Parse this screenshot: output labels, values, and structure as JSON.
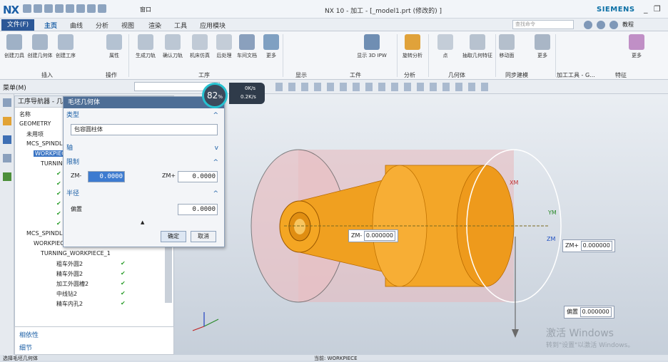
{
  "title_bar": {
    "logo": "NX",
    "qat_menu": "窗口",
    "title": "NX 10 - 加工 - [_model1.prt  (修改的) ]",
    "brand": "SIEMENS"
  },
  "menu_bar": {
    "file": "文件(F)",
    "tabs": [
      "主页",
      "曲线",
      "分析",
      "视图",
      "渲染",
      "工具",
      "应用模块"
    ],
    "search_placeholder": "查找命令",
    "tutorial": "教程"
  },
  "ribbon": {
    "buttons": [
      {
        "label": "创建刀具",
        "icon": "create-tool-icon"
      },
      {
        "label": "创建几何体",
        "icon": "create-geometry-icon"
      },
      {
        "label": "创建工序",
        "icon": "create-operation-icon"
      },
      {
        "label": "属性",
        "icon": "properties-icon"
      },
      {
        "label": "生成刀轨",
        "icon": "generate-toolpath-icon"
      },
      {
        "label": "确认刀轨",
        "icon": "verify-toolpath-icon"
      },
      {
        "label": "机床仿真",
        "icon": "machine-simulation-icon"
      },
      {
        "label": "后处理",
        "icon": "post-process-icon"
      },
      {
        "label": "车间文档",
        "icon": "shop-doc-icon"
      },
      {
        "label": "更多",
        "icon": "more-icon"
      },
      {
        "label": "显示 3D IPW",
        "icon": "display-ipw-icon"
      },
      {
        "label": "旋转分析",
        "icon": "rotate-analysis-icon"
      },
      {
        "label": "点",
        "icon": "point-icon"
      },
      {
        "label": "抽取几何特征",
        "icon": "extract-geometry-icon"
      },
      {
        "label": "移动面",
        "icon": "move-face-icon"
      },
      {
        "label": "更多",
        "icon": "more-icon"
      },
      {
        "label": "更多",
        "icon": "more-icon"
      }
    ],
    "groups": [
      "插入",
      "操作",
      "工序",
      "显示",
      "工件",
      "分析",
      "几何体",
      "同步建模",
      "加工工具 - G...",
      "特征"
    ]
  },
  "toolbar2": {
    "menu": "菜单(M)"
  },
  "speed_widget": {
    "percent": "82",
    "up": "0K/s",
    "down": "0.2K/s"
  },
  "navigator": {
    "title": "工序导航器 - 几何",
    "column": "名称",
    "rows": [
      {
        "text": "GEOMETRY",
        "check": ""
      },
      {
        "text": "未用项",
        "check": ""
      },
      {
        "text": "MCS_SPINDLE",
        "check": ""
      },
      {
        "text": "WORKPIECE",
        "check": ""
      },
      {
        "text": "TURNING_WORKPIECE",
        "check": ""
      },
      {
        "text": "",
        "check": "✔"
      },
      {
        "text": "",
        "check": "✔"
      },
      {
        "text": "",
        "check": "✔"
      },
      {
        "text": "",
        "check": "✔"
      },
      {
        "text": "",
        "check": "✔"
      },
      {
        "text": "",
        "check": "✔"
      },
      {
        "text": "MCS_SPINDLE_1",
        "check": ""
      },
      {
        "text": "WORKPIECE_1",
        "check": ""
      },
      {
        "text": "TURNING_WORKPIECE_1",
        "check": ""
      },
      {
        "text": "粗车外圆2",
        "check": "✔"
      },
      {
        "text": "精车外圆2",
        "check": "✔"
      },
      {
        "text": "加工外圆槽2",
        "check": "✔"
      },
      {
        "text": "中线钻2",
        "check": "✔"
      },
      {
        "text": "精车内孔2",
        "check": "✔"
      }
    ],
    "panels": [
      "相依性",
      "细节"
    ]
  },
  "dialog": {
    "title": "毛坯几何体",
    "type_section": "类型",
    "type_value": "包容圆柱体",
    "axis_section": "轴",
    "limit_section": "限制",
    "zm_minus_label": "ZM-",
    "zm_minus_value": "0.0000",
    "zm_plus_label": "ZM+",
    "zm_plus_value": "0.0000",
    "radius_section": "半径",
    "offset_label": "偏置",
    "offset_value": "0.0000",
    "ok": "确定",
    "cancel": "取消"
  },
  "viewport": {
    "zm_minus": {
      "label": "ZM-",
      "value": "0.000000"
    },
    "zm_plus": {
      "label": "ZM+",
      "value": "0.000000"
    },
    "offset": {
      "label": "偏置",
      "value": "0.000000"
    },
    "axes": {
      "xm": "XM",
      "ym": "YM",
      "zm": "ZM"
    }
  },
  "watermark": {
    "line1": "激活 Windows",
    "line2": "转到\"设置\"以激活 Windows。"
  },
  "status_bar": {
    "left": "选择毛坯几何体",
    "center": "当前: WORKPIECE"
  }
}
